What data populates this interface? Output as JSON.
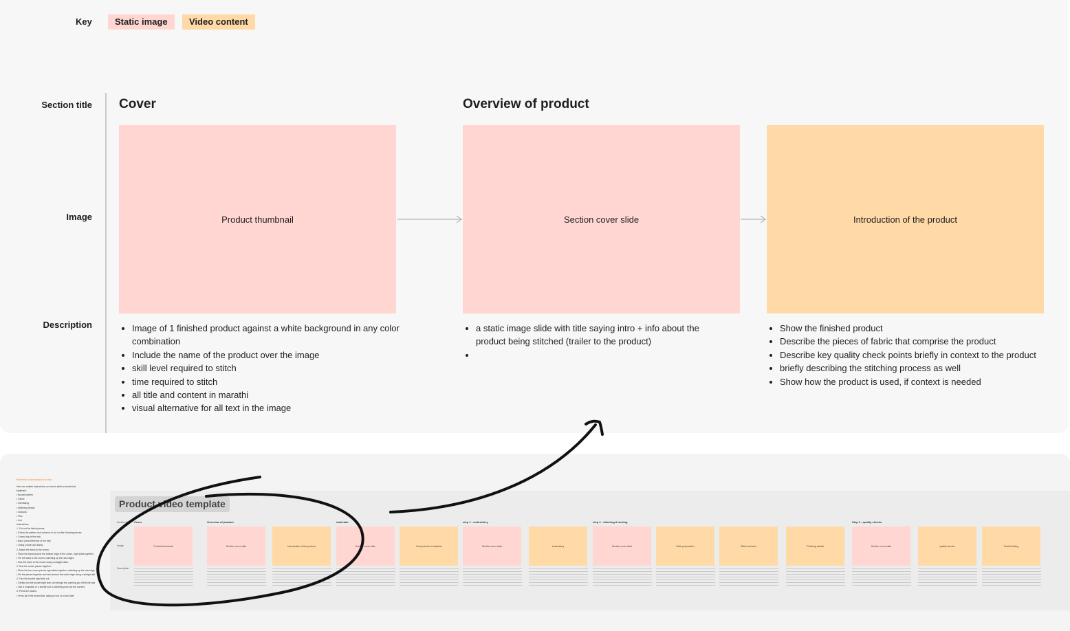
{
  "key": {
    "label": "Key",
    "static": "Static image",
    "video": "Video content"
  },
  "rows": {
    "section_title": "Section title",
    "image": "Image",
    "description": "Description"
  },
  "sections": {
    "cover": "Cover",
    "overview": "Overview of product"
  },
  "frames": [
    {
      "label": "Product thumbnail",
      "kind": "static"
    },
    {
      "label": "Section cover slide",
      "kind": "static"
    },
    {
      "label": "Introduction of the product",
      "kind": "video"
    }
  ],
  "descriptions": [
    [
      "Image of 1 finished product against a white background in any color combination",
      "Include the name of the product over the image",
      "skill level required to stitch",
      "time required to stitch",
      "all title and content in marathi",
      "visual alternative for all text in the image"
    ],
    [
      "a static image slide with title saying intro + info about the product being stitched (trailer to the product)",
      ""
    ],
    [
      "Show the finished product",
      "Describe the pieces of fabric that comprise the product",
      "Describe key quality check points briefly in context to the product",
      "briefly describing the stitching process as well",
      "Show how the product is used, if context is needed"
    ]
  ],
  "colors": {
    "static": "#ffd6d1",
    "video": "#ffd9a6"
  },
  "overview_board": {
    "title": "Product video template",
    "notes_title": "Reference instructions for a hat",
    "notes_lines": [
      "Here are written instructions on how to stitch a bucket hat.",
      "Materials:",
      "• Bucket pattern",
      "• Fabric",
      "• Interfacing",
      "• Matching thread",
      "• Scissors",
      "• Pins",
      "• Iron",
      "Instructions:",
      "1. Cut out the fabric pieces.",
      "   • Follow the pattern and scissors to cut out the following pieces:",
      "     • Crown (top of the hat)",
      "     • Band (circumference of the hat)",
      "     • Lining (crown and band)",
      "2. Attach the band to the crown.",
      "   • Place the band around the bottom edge of the crown, right sides together.",
      "   • Pin the band to the crown, matching up the raw edges.",
      "   • Sew the band to the crown using a straight stitch.",
      "3. Sew the crown pieces together.",
      "   • Place the two crown pieces right sides together, matching up the raw edges.",
      "   • Pin the pieces together and sew around the outer edge using a straight stitch.",
      "4. Turn the bucket right side out.",
      "   • Gently turn the bucket right side out through the opening you left in the seam.",
      "   • Use a chopstick or a similar tool to carefully push out the corners.",
      "5. Press the seams.",
      "   • Press all of the seams flat, using an iron on a low heat"
    ],
    "row_labels": [
      "Section title",
      "Image",
      "Description"
    ],
    "mini_sections": [
      "Cover",
      "Overview of product",
      "materials",
      "step 1 - embroidery",
      "step 2 - stitching & sewing",
      "Step 3 - quality checks"
    ],
    "mini_frames": [
      {
        "label": "Product thumbnail",
        "kind": "static"
      },
      {
        "label": "Section cover slide",
        "kind": "static"
      },
      {
        "label": "Introduction of the product",
        "kind": "video"
      },
      {
        "label": "Section cover slide",
        "kind": "static"
      },
      {
        "label": "Components of material",
        "kind": "video"
      },
      {
        "label": "Section cover slide",
        "kind": "static"
      },
      {
        "label": "embroidery",
        "kind": "video"
      },
      {
        "label": "Section cover slide",
        "kind": "static"
      },
      {
        "label": "Cloth preparation",
        "kind": "video"
      },
      {
        "label": "Stitch and sew",
        "kind": "video"
      },
      {
        "label": "Finishing details",
        "kind": "video"
      },
      {
        "label": "Section cover slide",
        "kind": "static"
      },
      {
        "label": "quality checks",
        "kind": "video"
      },
      {
        "label": "Final finishing",
        "kind": "video"
      }
    ]
  }
}
